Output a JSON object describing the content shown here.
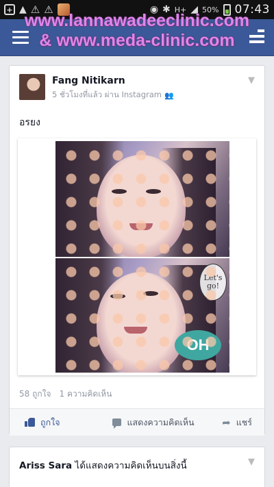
{
  "watermark": {
    "line1": "www.lannawadeeclinic.com",
    "line2": "& www.meda-clinic.com"
  },
  "status_bar": {
    "network": "H+",
    "battery": "50%",
    "time": "07:43"
  },
  "post": {
    "author": "Fang Nitikarn",
    "meta": "5 ชั่วโมงที่แล้ว ผ่าน Instagram",
    "text": "อรยง",
    "photo_sticker_oh": "OH",
    "photo_sticker_go": "Let's go!",
    "likes": "58 ถูกใจ",
    "comments_count": "1 ความคิดเห็น",
    "actions": {
      "like": "ถูกใจ",
      "comment": "แสดงความคิดเห็น",
      "share": "แชร์"
    }
  },
  "next_story": {
    "actor": "Ariss Sara",
    "text": "ได้แสดงความคิดเห็นบนสิ่งนี้"
  },
  "colors": {
    "facebook_blue": "#3b5998",
    "watermark_pink": "#e085ec"
  },
  "icons": [
    "menu-icon",
    "friend-requests-icon",
    "people-icon",
    "chevron-down-icon",
    "like-icon",
    "comment-icon",
    "share-icon"
  ]
}
